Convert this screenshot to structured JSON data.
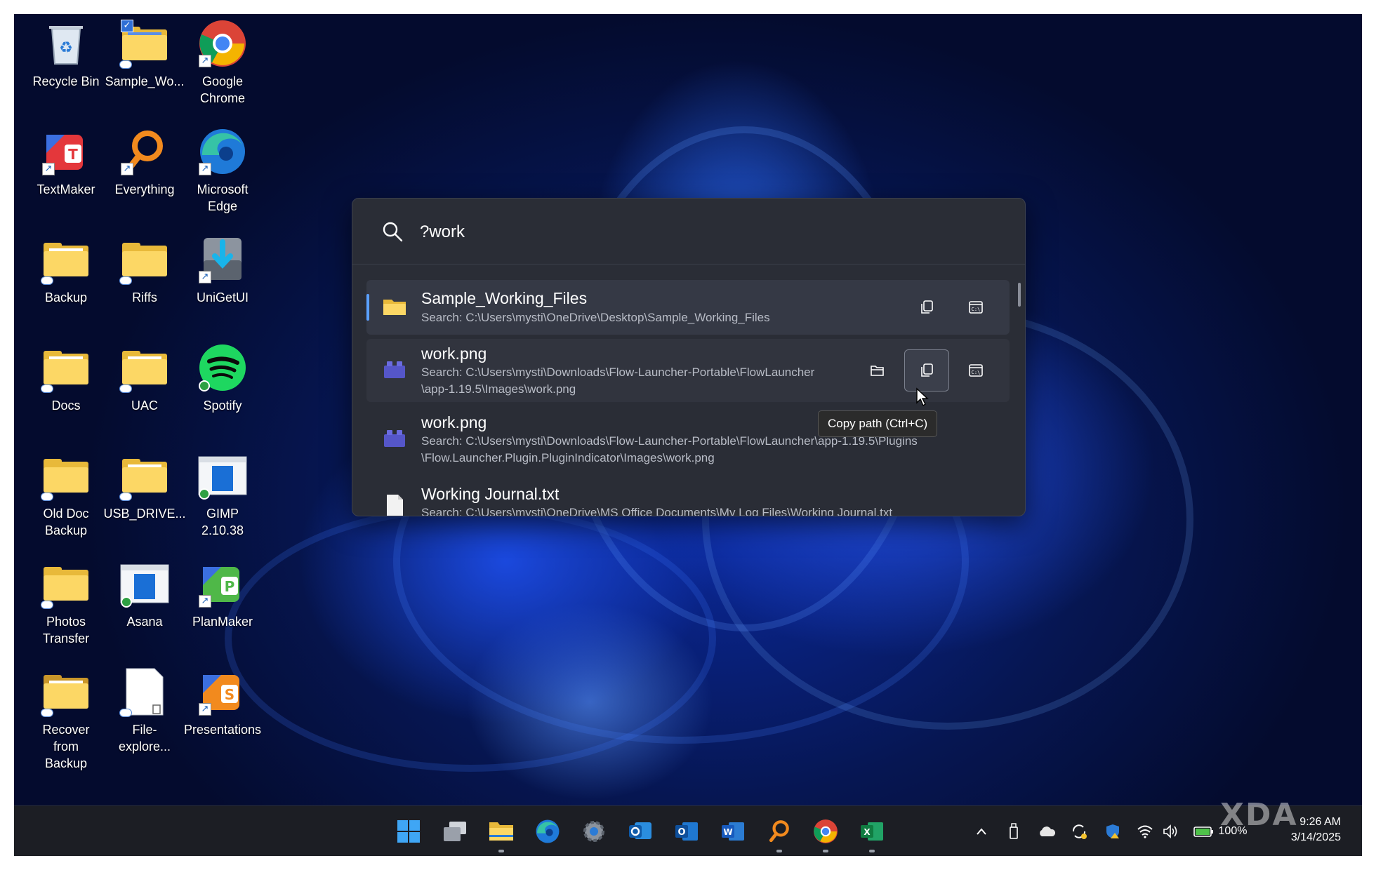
{
  "desktop": {
    "icons": [
      {
        "label": "Recycle Bin",
        "icon": "recycle-bin-icon"
      },
      {
        "label": "Sample_Wo...",
        "icon": "folder-icon"
      },
      {
        "label": "Google\nChrome",
        "icon": "chrome-icon"
      },
      {
        "label": "TextMaker",
        "icon": "textmaker-icon"
      },
      {
        "label": "Everything",
        "icon": "everything-icon"
      },
      {
        "label": "Microsoft\nEdge",
        "icon": "edge-icon"
      },
      {
        "label": "Backup",
        "icon": "folder-icon"
      },
      {
        "label": "Riffs",
        "icon": "folder-icon"
      },
      {
        "label": "UniGetUI",
        "icon": "unigetui-icon"
      },
      {
        "label": "Docs",
        "icon": "folder-icon"
      },
      {
        "label": "UAC",
        "icon": "folder-icon"
      },
      {
        "label": "Spotify",
        "icon": "spotify-icon"
      },
      {
        "label": "Old Doc\nBackup",
        "icon": "folder-icon"
      },
      {
        "label": "USB_DRIVE...",
        "icon": "folder-icon"
      },
      {
        "label": "GIMP 2.10.38",
        "icon": "gimp-icon"
      },
      {
        "label": "Photos\nTransfer",
        "icon": "folder-icon"
      },
      {
        "label": "Asana",
        "icon": "asana-icon"
      },
      {
        "label": "PlanMaker",
        "icon": "planmaker-icon"
      },
      {
        "label": "Recover from\nBackup",
        "icon": "folder-icon"
      },
      {
        "label": "File-explore...",
        "icon": "document-icon"
      },
      {
        "label": "Presentations",
        "icon": "presentations-icon"
      }
    ]
  },
  "launcher": {
    "query": "?work",
    "results": [
      {
        "title": "Sample_Working_Files",
        "subtitle": "Search: C:\\Users\\mysti\\OneDrive\\Desktop\\Sample_Working_Files",
        "icon": "folder-icon"
      },
      {
        "title": "work.png",
        "subtitle": "Search: C:\\Users\\mysti\\Downloads\\Flow-Launcher-Portable\\FlowLauncher\n\\app-1.19.5\\Images\\work.png",
        "icon": "lego-icon"
      },
      {
        "title": "work.png",
        "subtitle": "Search: C:\\Users\\mysti\\Downloads\\Flow-Launcher-Portable\\FlowLauncher\\app-1.19.5\\Plugins\n\\Flow.Launcher.Plugin.PluginIndicator\\Images\\work.png",
        "icon": "lego-icon"
      },
      {
        "title": "Working Journal.txt",
        "subtitle": "Search: C:\\Users\\mysti\\OneDrive\\MS Office Documents\\My Log Files\\Working Journal.txt",
        "icon": "text-file-icon"
      }
    ],
    "tooltip": "Copy path (Ctrl+C)"
  },
  "taskbar": {
    "apps": [
      "start-icon",
      "task-view-icon",
      "file-explorer-icon",
      "edge-icon",
      "settings-icon",
      "outlook-new-icon",
      "outlook-icon",
      "word-icon",
      "everything-icon",
      "chrome-icon",
      "excel-icon"
    ],
    "battery": "100%",
    "time": "9:26 AM",
    "date": "3/14/2025"
  },
  "watermark": "XDA",
  "colors": {
    "accent": "#5aa0ff",
    "launcher_bg": "#2a2d36",
    "taskbar_bg": "#1c1e24",
    "folder": "#fcd765"
  }
}
